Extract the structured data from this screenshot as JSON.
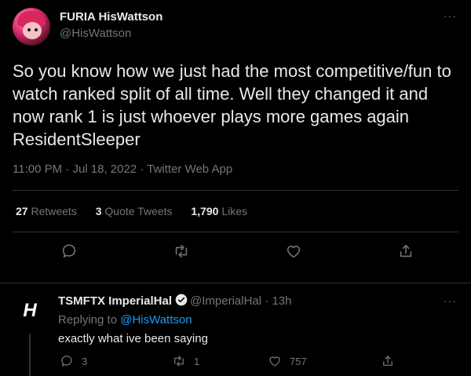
{
  "main_tweet": {
    "display_name": "FURIA HisWattson",
    "handle": "@HisWattson",
    "more_label": "···",
    "text": "So you know how we just had the most competitive/fun to watch ranked split of all time. Well they changed it and now rank 1 is just whoever plays more games again ResidentSleeper",
    "time": "11:00 PM",
    "date": "Jul 18, 2022",
    "source": "Twitter Web App",
    "separator": " · ",
    "stats": {
      "retweets_count": "27",
      "retweets_label": " Retweets",
      "quotes_count": "3",
      "quotes_label": " Quote Tweets",
      "likes_count": "1,790",
      "likes_label": " Likes"
    },
    "actions": [
      "reply-icon",
      "retweet-icon",
      "like-icon",
      "share-icon"
    ]
  },
  "reply": {
    "avatar_text": "H",
    "display_name": "TSMFTX ImperialHal",
    "handle": "@ImperialHal",
    "separator": " · ",
    "age": "13h",
    "more_label": "···",
    "replying_prefix": "Replying to ",
    "replying_to": "@HisWattson",
    "text": "exactly what ive been saying",
    "reply_count": "3",
    "retweet_count": "1",
    "like_count": "757"
  },
  "colors": {
    "background": "#000000",
    "text": "#e7e9ea",
    "muted": "#71767b",
    "accent": "#1d9bf0",
    "divider": "#2f3336"
  }
}
